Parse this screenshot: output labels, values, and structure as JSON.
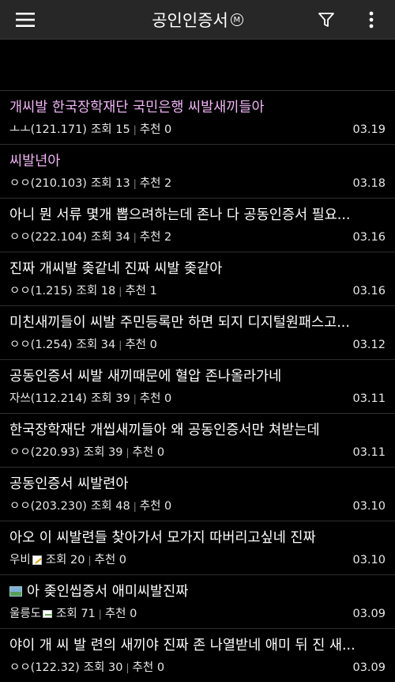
{
  "header": {
    "title": "공인인증서",
    "badge": "M",
    "menu_icon": "hamburger-icon",
    "filter_icon": "filter-icon",
    "more_icon": "more-vertical-icon"
  },
  "colors": {
    "background": "#000000",
    "topbar": "#272727",
    "visited_title": "#f0b5f5",
    "text": "#ffffff"
  },
  "posts": [
    {
      "title": "개씨발 한국장학재단 국민은행 씨발새끼들아",
      "visited": true,
      "author": "ㅗㅗ(121.171)",
      "views": "조회 15",
      "likes": "추천 0",
      "date": "03.19"
    },
    {
      "title": "씨발년아",
      "visited": true,
      "author": "ㅇㅇ(210.103)",
      "views": "조회 13",
      "likes": "추천 2",
      "date": "03.18"
    },
    {
      "title": "아니 뭔 서류 몇개 뽑으려하는데 존나 다 공동인증서 필요...",
      "visited": false,
      "author": "ㅇㅇ(222.104)",
      "views": "조회 34",
      "likes": "추천 2",
      "date": "03.16"
    },
    {
      "title": "진짜 개씨발 좆같네 진짜 씨발 좆같아",
      "visited": false,
      "author": "ㅇㅇ(1.215)",
      "views": "조회 18",
      "likes": "추천 1",
      "date": "03.16"
    },
    {
      "title": "미친새끼들이 씨발 주민등록만 하면 되지 디지털원패스고...",
      "visited": false,
      "author": "ㅇㅇ(1.254)",
      "views": "조회 34",
      "likes": "추천 0",
      "date": "03.12"
    },
    {
      "title": "공동인증서 씨발 새끼때문에 혈압 존나올라가네",
      "visited": false,
      "author": "자쓰(112.214)",
      "views": "조회 39",
      "likes": "추천 0",
      "date": "03.11"
    },
    {
      "title": "한국장학재단 개씹새끼들아 왜 공동인증서만 쳐받는데",
      "visited": false,
      "author": "ㅇㅇ(220.93)",
      "views": "조회 39",
      "likes": "추천 0",
      "date": "03.11"
    },
    {
      "title": "공동인증서 씨발련아",
      "visited": false,
      "author": "ㅇㅇ(203.230)",
      "views": "조회 48",
      "likes": "추천 0",
      "date": "03.10"
    },
    {
      "title": "아오 이 씨발련들 찾아가서 모가지 따버리고싶네 진짜",
      "visited": false,
      "author": "우비",
      "author_icon": "pen-icon",
      "views": "조회 20",
      "likes": "추천 0",
      "date": "03.10"
    },
    {
      "title": "아 좆인씹증서 애미씨발진짜",
      "visited": false,
      "title_icon": "image-icon",
      "author": "울릉도",
      "author_icon": "badge-icon",
      "views": "조회 71",
      "likes": "추천 0",
      "date": "03.09"
    },
    {
      "title": "야이 개 씨 발 련의 새끼야 진짜 존 나열받네 애미 뒤 진 새...",
      "visited": false,
      "author": "ㅇㅇ(122.32)",
      "views": "조회 30",
      "likes": "추천 0",
      "date": "03.09"
    }
  ]
}
